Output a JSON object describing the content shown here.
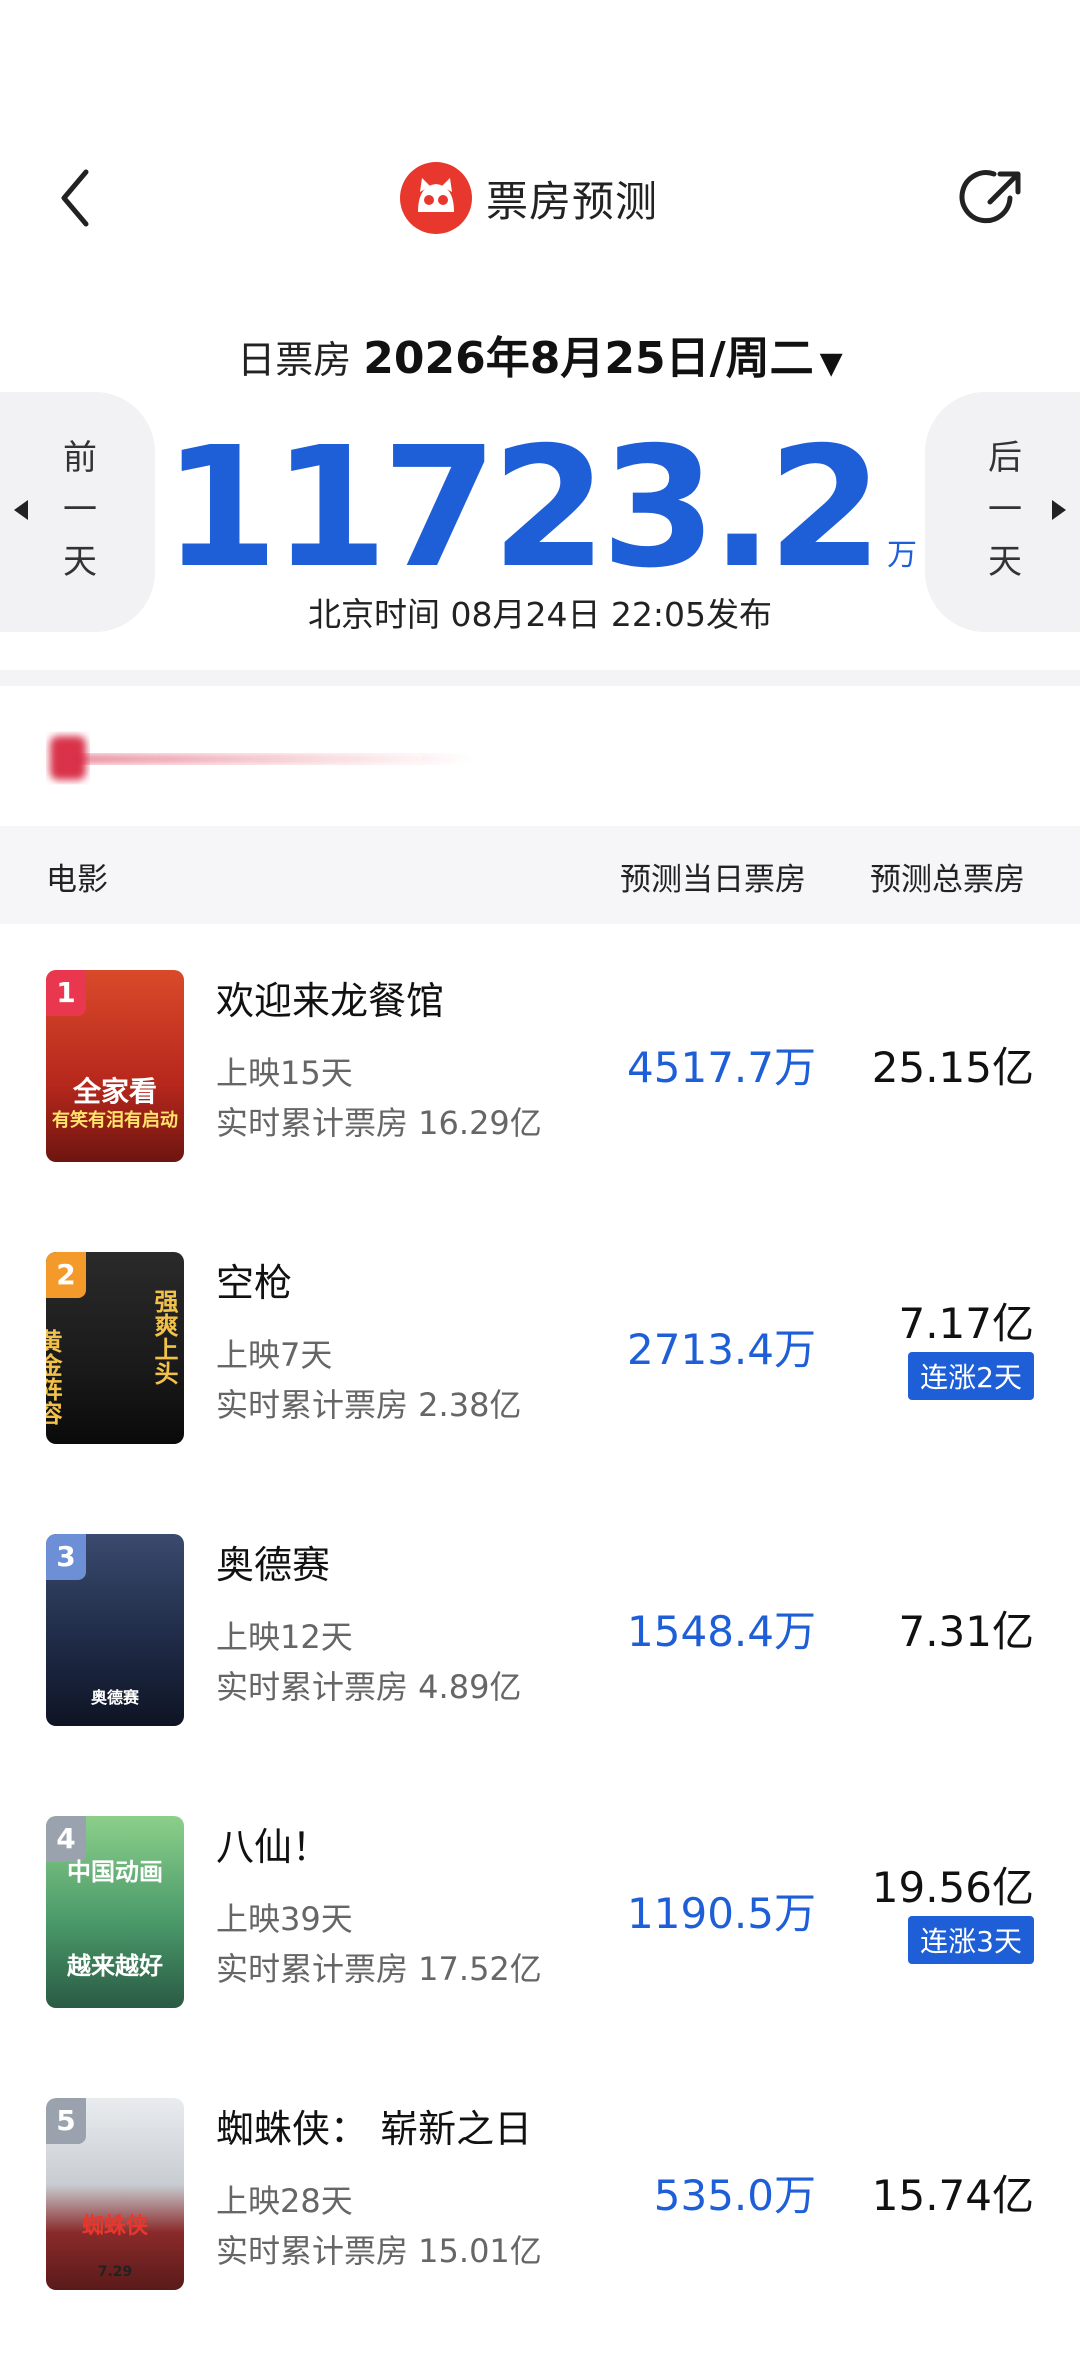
{
  "header": {
    "title": "票房预测"
  },
  "date": {
    "label": "日票房",
    "value": "2026年8月25日/周二"
  },
  "nav": {
    "prev_label": "前一天",
    "next_label": "后一天"
  },
  "total": {
    "value": "11723.2",
    "unit": "万"
  },
  "publish": {
    "text": "北京时间  08月24日  22:05发布"
  },
  "table": {
    "col_movie": "电影",
    "col_today": "预测当日票房",
    "col_total": "预测总票房"
  },
  "movies": [
    {
      "rank": "1",
      "name": "欢迎来龙餐馆",
      "days": "上映15天",
      "cumulative": "实时累计票房 16.29亿",
      "today": "4517.7万",
      "total": "25.15亿",
      "badge": "",
      "poster_text": "全家看",
      "poster_sub": "有笑有泪有启动"
    },
    {
      "rank": "2",
      "name": "空枪",
      "days": "上映7天",
      "cumulative": "实时累计票房 2.38亿",
      "today": "2713.4万",
      "total": "7.17亿",
      "badge": "连涨2天",
      "poster_text": "黄金阵容",
      "poster_sub": "强爽上头"
    },
    {
      "rank": "3",
      "name": "奥德赛",
      "days": "上映12天",
      "cumulative": "实时累计票房 4.89亿",
      "today": "1548.4万",
      "total": "7.31亿",
      "badge": "",
      "poster_text": "奥德赛",
      "poster_sub": ""
    },
    {
      "rank": "4",
      "name": "八仙！",
      "days": "上映39天",
      "cumulative": "实时累计票房 17.52亿",
      "today": "1190.5万",
      "total": "19.56亿",
      "badge": "连涨3天",
      "poster_text": "中国动画",
      "poster_sub": "越来越好"
    },
    {
      "rank": "5",
      "name": "蜘蛛侠： 崭新之日",
      "days": "上映28天",
      "cumulative": "实时累计票房 15.01亿",
      "today": "535.0万",
      "total": "15.74亿",
      "badge": "",
      "poster_text": "蜘蛛侠",
      "poster_sub": "7.29"
    }
  ],
  "colors": {
    "accent": "#1e5fd8",
    "brand": "#e8372c"
  }
}
